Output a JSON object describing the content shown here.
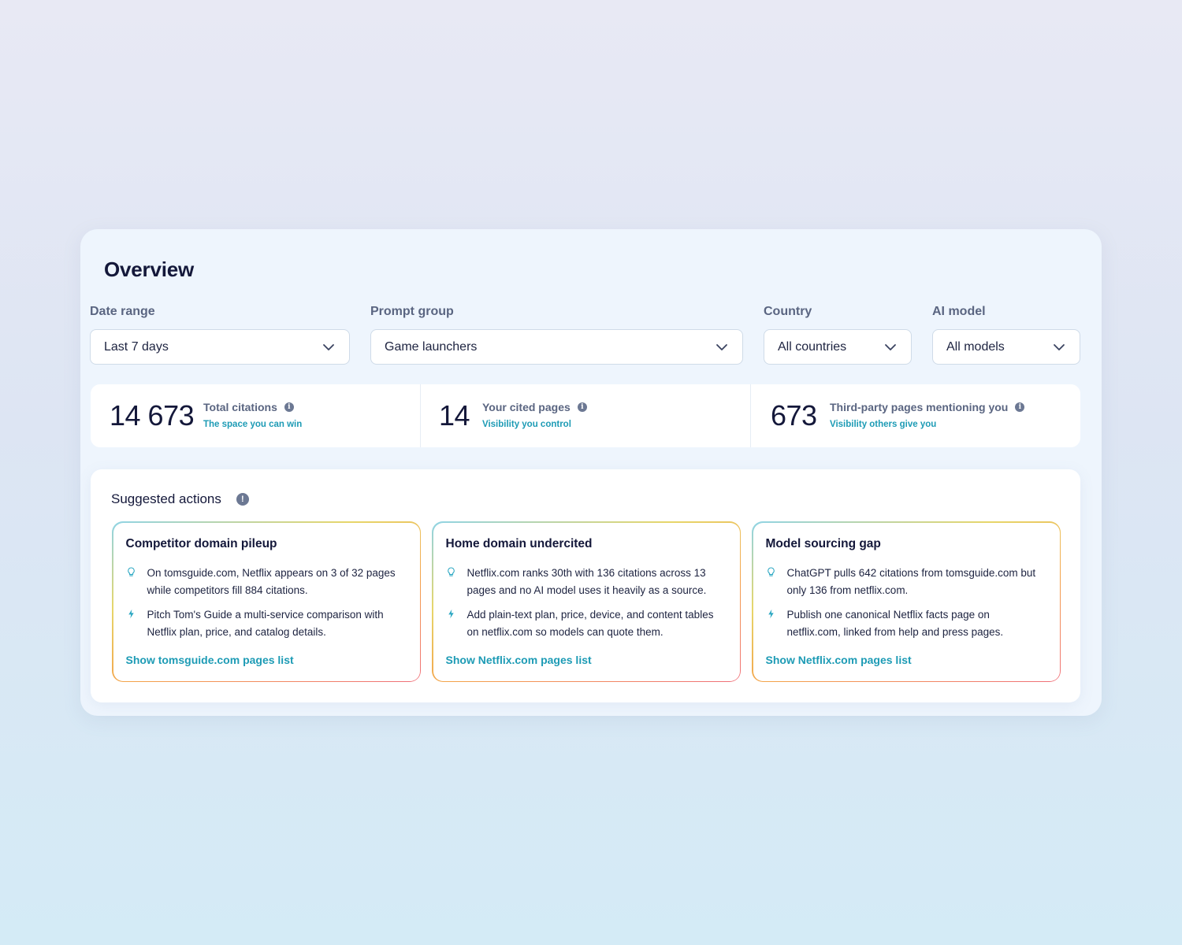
{
  "page_title": "Overview",
  "filters": {
    "date_range": {
      "label": "Date range",
      "value": "Last 7 days"
    },
    "prompt_group": {
      "label": "Prompt group",
      "value": "Game launchers"
    },
    "country": {
      "label": "Country",
      "value": "All countries"
    },
    "ai_model": {
      "label": "AI model",
      "value": "All models"
    }
  },
  "stats": [
    {
      "value": "14 673",
      "label": "Total citations",
      "sub": "The space you can win"
    },
    {
      "value": "14",
      "label": "Your cited pages",
      "sub": "Visibility you control"
    },
    {
      "value": "673",
      "label": "Third-party pages mentioning you",
      "sub": "Visibility others give you"
    }
  ],
  "suggested_actions": {
    "title": "Suggested actions",
    "cards": [
      {
        "title": "Competitor domain pileup",
        "insight": "On tomsguide.com, Netflix appears on 3 of 32 pages while competitors fill 884 citations.",
        "action": "Pitch Tom's Guide a multi-service comparison with Netflix plan, price, and catalog details.",
        "link": "Show tomsguide.com pages list"
      },
      {
        "title": "Home domain undercited",
        "insight": "Netflix.com ranks 30th with 136 citations across 13 pages and no AI model uses it heavily as a source.",
        "action": "Add plain-text plan, price, device, and content tables on netflix.com so models can quote them.",
        "link": "Show Netflix.com pages list"
      },
      {
        "title": "Model sourcing gap",
        "insight": "ChatGPT pulls 642 citations from tomsguide.com but only 136 from netflix.com.",
        "action": "Publish one canonical Netflix facts page on netflix.com, linked from help and press pages.",
        "link": "Show Netflix.com pages list"
      }
    ]
  },
  "icons": {
    "insight": "lightbulb-icon",
    "action": "lightning-bolt-icon",
    "dropdown": "chevron-down-icon",
    "info": "info-icon"
  },
  "colors": {
    "accent": "#1d9bb5",
    "text": "#14183a",
    "muted": "#5a6581"
  }
}
